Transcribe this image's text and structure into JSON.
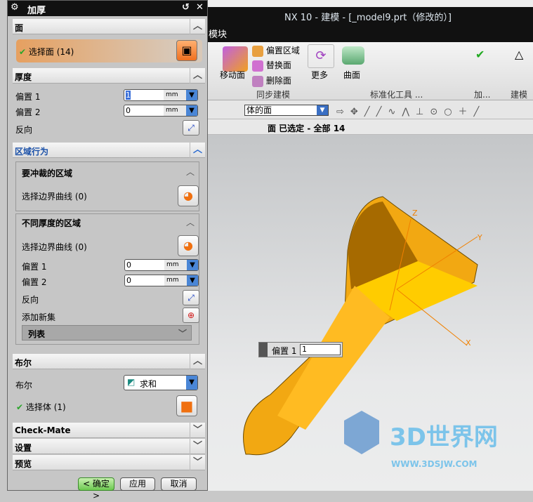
{
  "app": {
    "title": "NX 10 - 建模 - [_model9.prt（修改的）]",
    "menu_fragment": "模块",
    "ribbon": {
      "move_face": "移动面",
      "offset_region": "偏置区域",
      "replace_face": "替换面",
      "delete_face": "删除面",
      "more": "更多",
      "surface": "曲面",
      "groups": [
        "同步建模",
        "标准化工具 ...",
        "加...",
        "建模工"
      ]
    },
    "selection_filter": "体的面",
    "status": "面 已选定 - 全部 14"
  },
  "dialog": {
    "title": "加厚",
    "face": {
      "header": "面",
      "select_face": "选择面 (14)"
    },
    "thickness": {
      "header": "厚度",
      "offset1_label": "偏置 1",
      "offset1_value": "1",
      "offset2_label": "偏置 2",
      "offset2_value": "0",
      "unit": "mm",
      "reverse": "反向"
    },
    "region_behavior": {
      "header": "区域行为",
      "punch": {
        "header": "要冲裁的区域",
        "select_curve": "选择边界曲线 (0)"
      },
      "varying": {
        "header": "不同厚度的区域",
        "select_curve": "选择边界曲线 (0)",
        "offset1_label": "偏置 1",
        "offset1_value": "0",
        "offset2_label": "偏置 2",
        "offset2_value": "0",
        "unit": "mm",
        "reverse": "反向",
        "add_set": "添加新集",
        "list": "列表"
      }
    },
    "boolean": {
      "header": "布尔",
      "label": "布尔",
      "value": "求和",
      "select_body": "选择体 (1)"
    },
    "check_mate": "Check-Mate",
    "settings": "设置",
    "preview": "预览",
    "buttons": {
      "ok": "< 确定 >",
      "apply": "应用",
      "cancel": "取消"
    }
  },
  "viewport": {
    "screen_input_label": "偏置 1",
    "screen_input_value": "1",
    "axes": [
      "Z",
      "Y",
      "X"
    ],
    "watermark": "3D世界网",
    "watermark_url": "WWW.3DSJW.COM",
    "part_color": "#ffbb22"
  }
}
